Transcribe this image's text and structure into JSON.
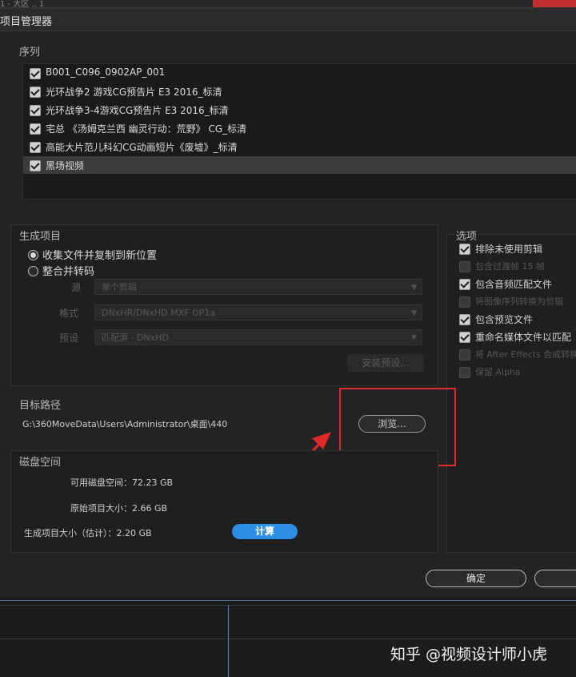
{
  "window": {
    "title": "项目管理器",
    "top_tab": "1 - 大区 .. 1"
  },
  "sequence": {
    "label": "序列",
    "items": [
      {
        "label": "B001_C096_0902AP_001",
        "checked": true
      },
      {
        "label": "光环战争2 游戏CG预告片 E3 2016_标清",
        "checked": true
      },
      {
        "label": "光环战争3-4游戏CG预告片 E3 2016_标清",
        "checked": true
      },
      {
        "label": "宅总 《汤姆克兰西 幽灵行动：荒野》 CG_标清",
        "checked": true
      },
      {
        "label": "高能大片范儿科幻CG动画短片《废墟》_标清",
        "checked": true
      },
      {
        "label": "黑场视频",
        "checked": true
      }
    ]
  },
  "generate": {
    "label": "生成项目",
    "option_collect": "收集文件并复制到新位置",
    "option_consolidate": "整合并转码",
    "source_label": "源",
    "source_value": "单个剪辑",
    "format_label": "格式",
    "format_value": "DNxHR/DNxHD MXF OP1a",
    "preset_label": "预设",
    "preset_value": "匹配源 - DNxHD",
    "install_preset": "安装预设..."
  },
  "options": {
    "label": "选项",
    "items": [
      {
        "label": "排除未使用剪辑",
        "checked": true
      },
      {
        "label": "包含过渡帧  15 帧",
        "checked": false
      },
      {
        "label": "包含音频匹配文件",
        "checked": true
      },
      {
        "label": "将图像序列转换为剪辑",
        "checked": false
      },
      {
        "label": "包含预览文件",
        "checked": true
      },
      {
        "label": "重命名媒体文件以匹配",
        "checked": true
      },
      {
        "label": "将 After Effects 合成转换",
        "checked": false
      },
      {
        "label": "保留 Alpha",
        "checked": false
      }
    ]
  },
  "target": {
    "label": "目标路径",
    "path": "G:\\360MoveData\\Users\\Administrator\\桌面\\440",
    "browse": "浏览..."
  },
  "disk": {
    "label": "磁盘空间",
    "available": "可用磁盘空间：72.23 GB",
    "original": "原始项目大小：2.66 GB",
    "generated": "生成项目大小（估计）：2.20 GB",
    "calc_button": "计算"
  },
  "footer": {
    "ok": "确定",
    "cancel": ""
  },
  "watermark": "知乎 @视频设计师小虎",
  "colors": {
    "accent_blue": "#2d8ee8",
    "highlight_red": "#e02a2a",
    "bg": "#232323"
  }
}
